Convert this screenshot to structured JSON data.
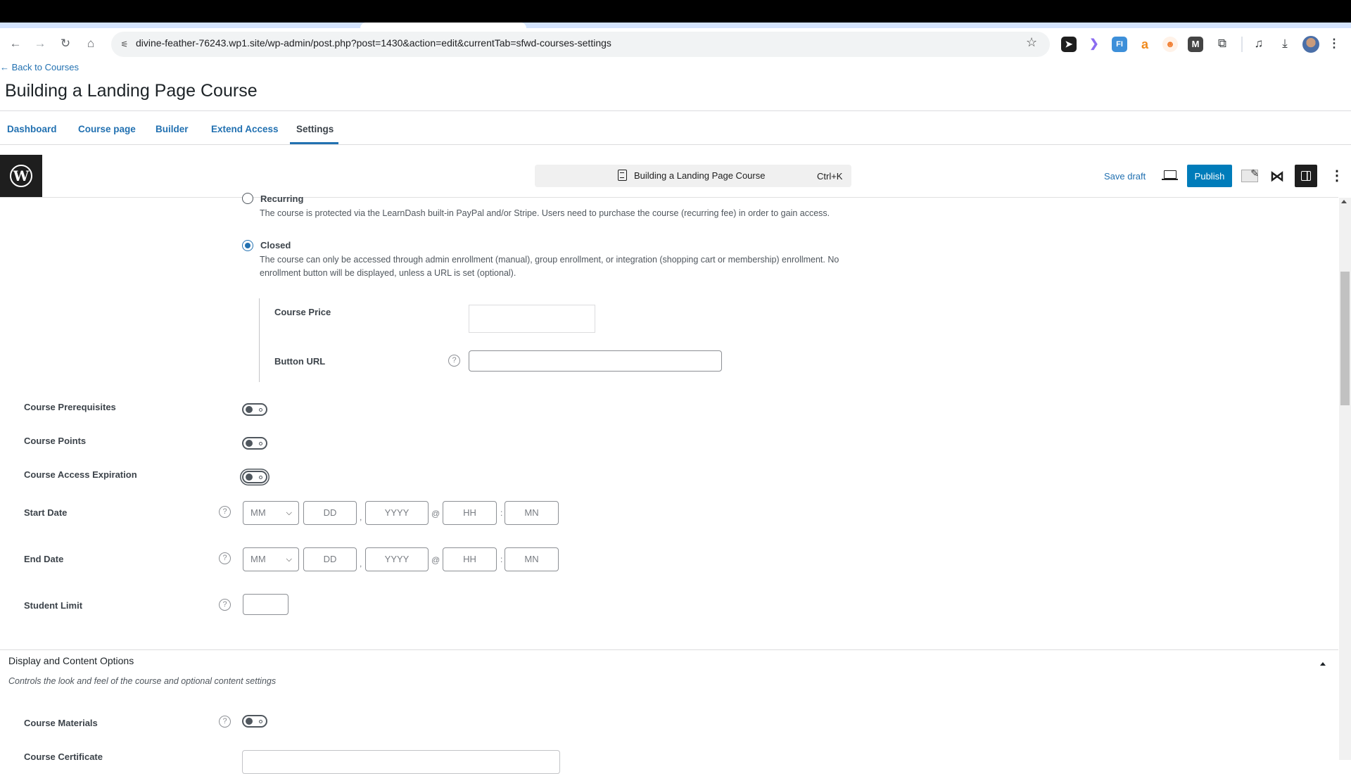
{
  "browser": {
    "url": "divine-feather-76243.wp1.site/wp-admin/post.php?post=1430&action=edit&currentTab=sfwd-courses-settings",
    "nav_icons": [
      "back-icon",
      "forward-icon",
      "reload-icon",
      "home-icon"
    ],
    "extensions": [
      {
        "name": "cursor-extension-icon",
        "glyph": "➤",
        "color": "#1e1e1e"
      },
      {
        "name": "purple-extension-icon",
        "glyph": "❯",
        "color": "#8b6cf0"
      },
      {
        "name": "fi-extension-icon",
        "glyph": "FI",
        "color": "#3d8fd9"
      },
      {
        "name": "amazon-extension-icon",
        "glyph": "a",
        "color": "#f08a1c"
      },
      {
        "name": "robot-extension-icon",
        "glyph": "☻",
        "color": "#f07a2a"
      },
      {
        "name": "m-extension-icon",
        "glyph": "M",
        "color": "#444444"
      },
      {
        "name": "extensions-puzzle-icon",
        "glyph": "⧉",
        "color": "#3c4043"
      }
    ]
  },
  "header": {
    "back_link": "← Back to Courses",
    "title": "Building a Landing Page Course",
    "tabs": [
      {
        "label": "Dashboard",
        "active": false
      },
      {
        "label": "Course page",
        "active": false
      },
      {
        "label": "Builder",
        "active": false
      },
      {
        "label": "Extend Access",
        "active": false
      },
      {
        "label": "Settings",
        "active": true
      }
    ]
  },
  "editor": {
    "command_bar_title": "Building a Landing Page Course",
    "command_bar_shortcut": "Ctrl+K",
    "save_draft": "Save draft",
    "publish": "Publish",
    "accent_color": "#007cba"
  },
  "access_mode": {
    "options": [
      {
        "label": "Recurring",
        "checked": false,
        "description": "The course is protected via the LearnDash built-in PayPal and/or Stripe. Users need to purchase the course (recurring fee) in order to gain access."
      },
      {
        "label": "Closed",
        "checked": true,
        "description_line1": "The course can only be accessed through admin enrollment (manual), group enrollment, or integration (shopping cart or membership) enrollment. No",
        "description_line2": "enrollment button will be displayed, unless a URL is set (optional)."
      }
    ],
    "course_price_label": "Course Price",
    "course_price_value": "",
    "button_url_label": "Button URL",
    "button_url_value": ""
  },
  "settings": {
    "toggles": [
      {
        "label": "Course Prerequisites",
        "on": false
      },
      {
        "label": "Course Points",
        "on": false
      },
      {
        "label": "Course Access Expiration",
        "on": false
      }
    ],
    "start_date": {
      "label": "Start Date",
      "month": "MM",
      "day": "DD",
      "year": "YYYY",
      "hour": "HH",
      "minute": "MN"
    },
    "end_date": {
      "label": "End Date",
      "month": "MM",
      "day": "DD",
      "year": "YYYY",
      "hour": "HH",
      "minute": "MN"
    },
    "separators": {
      "comma": ",",
      "at": "@",
      "colon": ":"
    },
    "student_limit": {
      "label": "Student Limit",
      "value": ""
    }
  },
  "display_section": {
    "title": "Display and Content Options",
    "description": "Controls the look and feel of the course and optional content settings",
    "course_materials": {
      "label": "Course Materials",
      "on": false
    },
    "course_certificate": {
      "label": "Course Certificate"
    }
  }
}
